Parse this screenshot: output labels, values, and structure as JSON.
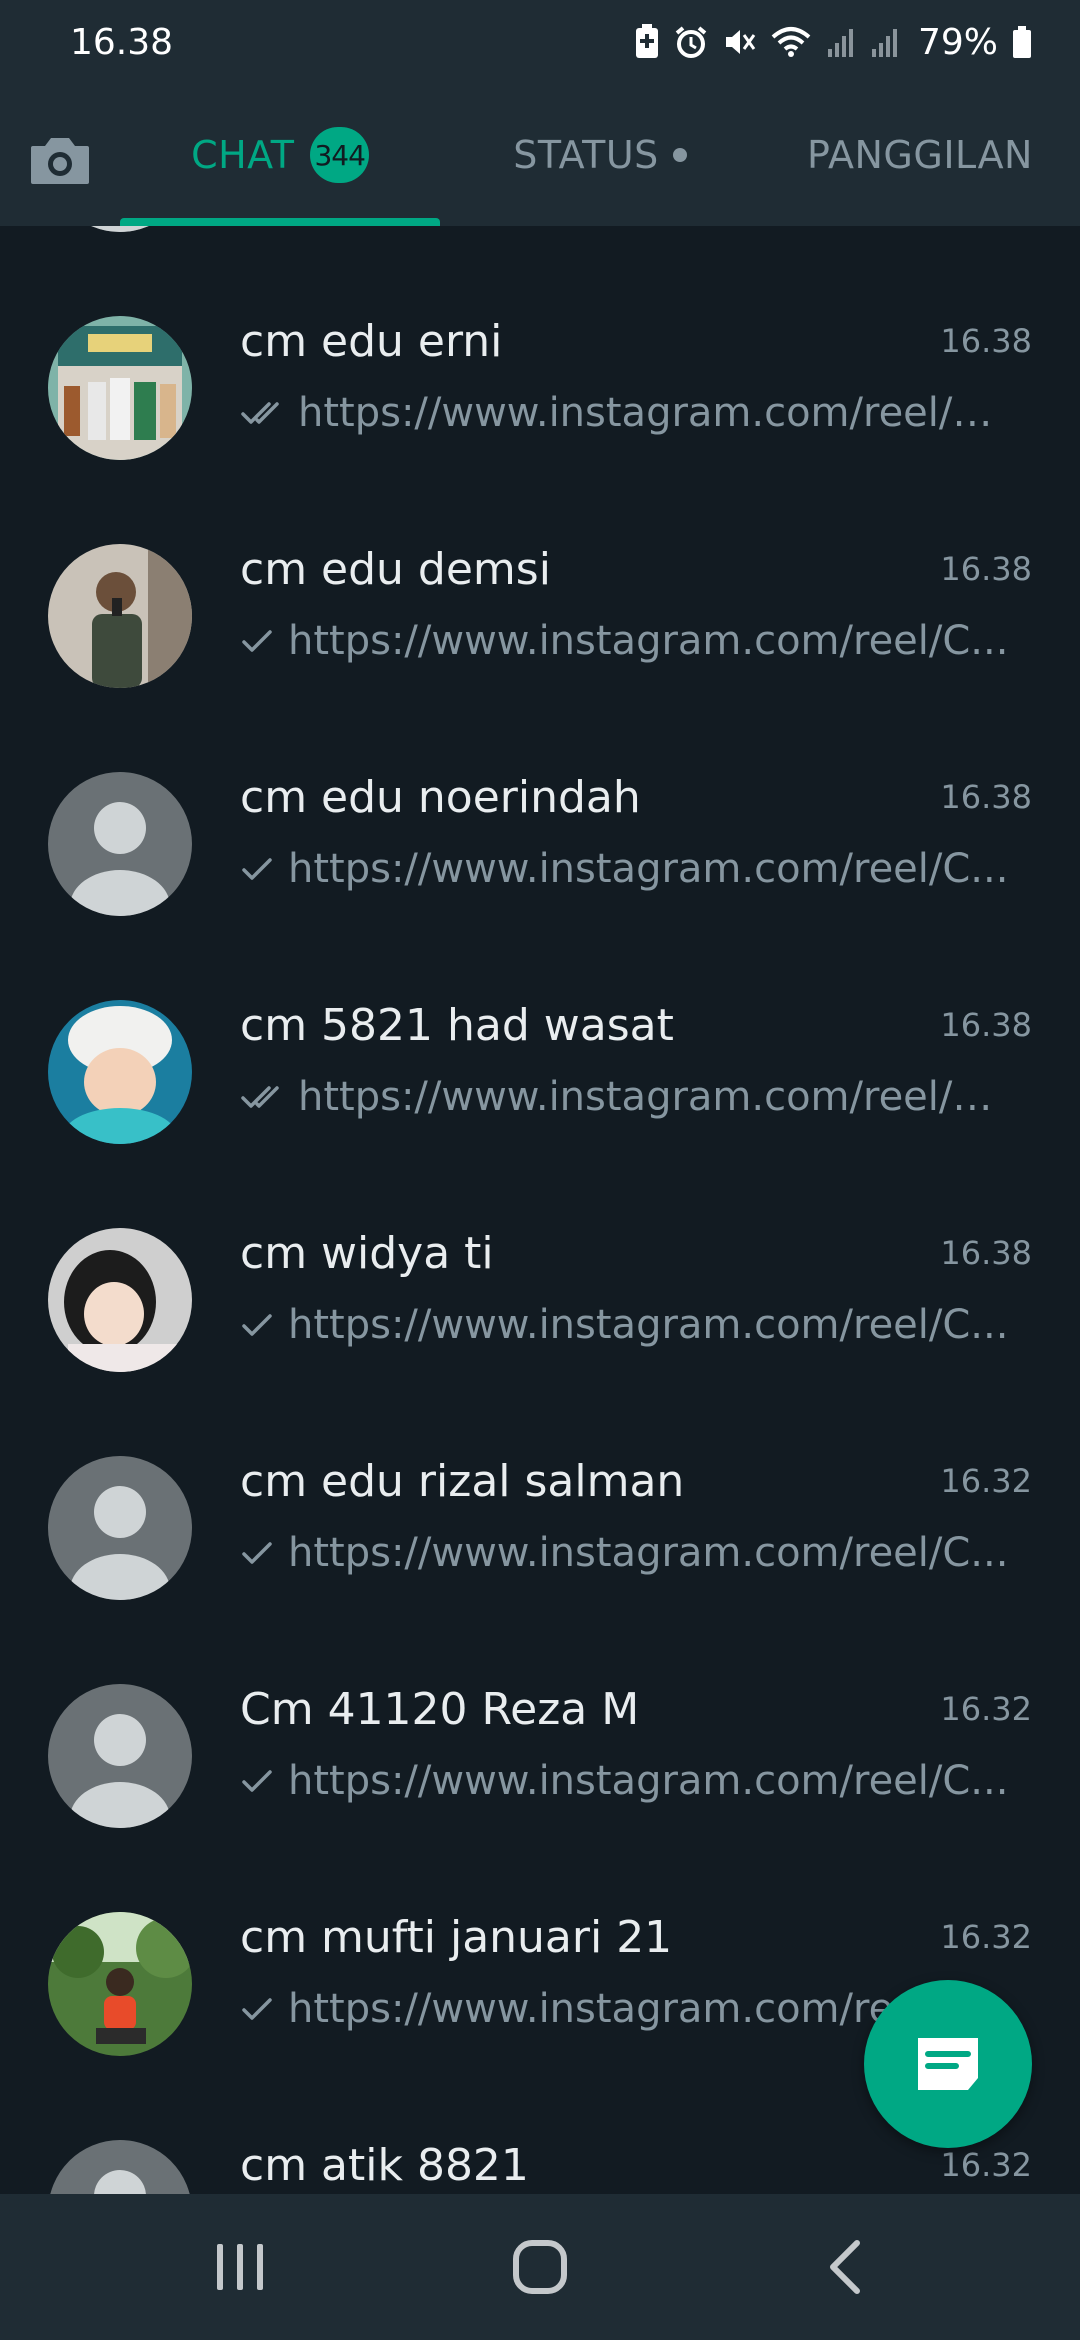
{
  "statusbar": {
    "time": "16.38",
    "battery": "79%"
  },
  "tabs": {
    "chat": "CHAT",
    "chat_badge": "344",
    "status": "STATUS",
    "calls": "PANGGILAN"
  },
  "chats": [
    {
      "name": "cm edu erni",
      "time": "16.38",
      "preview": "https://www.instagram.com/reel/C...",
      "tick": "double",
      "avatar": "photo-group"
    },
    {
      "name": "cm edu demsi",
      "time": "16.38",
      "preview": "https://www.instagram.com/reel/C...",
      "tick": "single",
      "avatar": "photo-man"
    },
    {
      "name": "cm edu noerindah",
      "time": "16.38",
      "preview": "https://www.instagram.com/reel/C...",
      "tick": "single",
      "avatar": "default"
    },
    {
      "name": "cm 5821 had wasat",
      "time": "16.38",
      "preview": "https://www.instagram.com/reel/C...",
      "tick": "double",
      "avatar": "photo-child"
    },
    {
      "name": "cm widya ti",
      "time": "16.38",
      "preview": "https://www.instagram.com/reel/C...",
      "tick": "single",
      "avatar": "photo-hijab"
    },
    {
      "name": "cm edu rizal salman",
      "time": "16.32",
      "preview": "https://www.instagram.com/reel/C...",
      "tick": "single",
      "avatar": "default"
    },
    {
      "name": "Cm 41120 Reza M",
      "time": "16.32",
      "preview": "https://www.instagram.com/reel/C...",
      "tick": "single",
      "avatar": "default"
    },
    {
      "name": "cm mufti januari 21",
      "time": "16.32",
      "preview": "https://www.instagram.com/reel/C...",
      "tick": "single",
      "avatar": "photo-outdoor"
    },
    {
      "name": "cm atik 8821",
      "time": "16.32",
      "preview": "",
      "tick": "single",
      "avatar": "default"
    }
  ],
  "colors": {
    "accent": "#00a884",
    "background": "#121b22",
    "header": "#1f2c34",
    "secondary_text": "#8696a0"
  },
  "icons": {
    "camera": "camera-icon",
    "new_chat": "new-chat-icon",
    "nav_recent": "recent-apps-icon",
    "nav_home": "home-icon",
    "nav_back": "back-icon"
  }
}
